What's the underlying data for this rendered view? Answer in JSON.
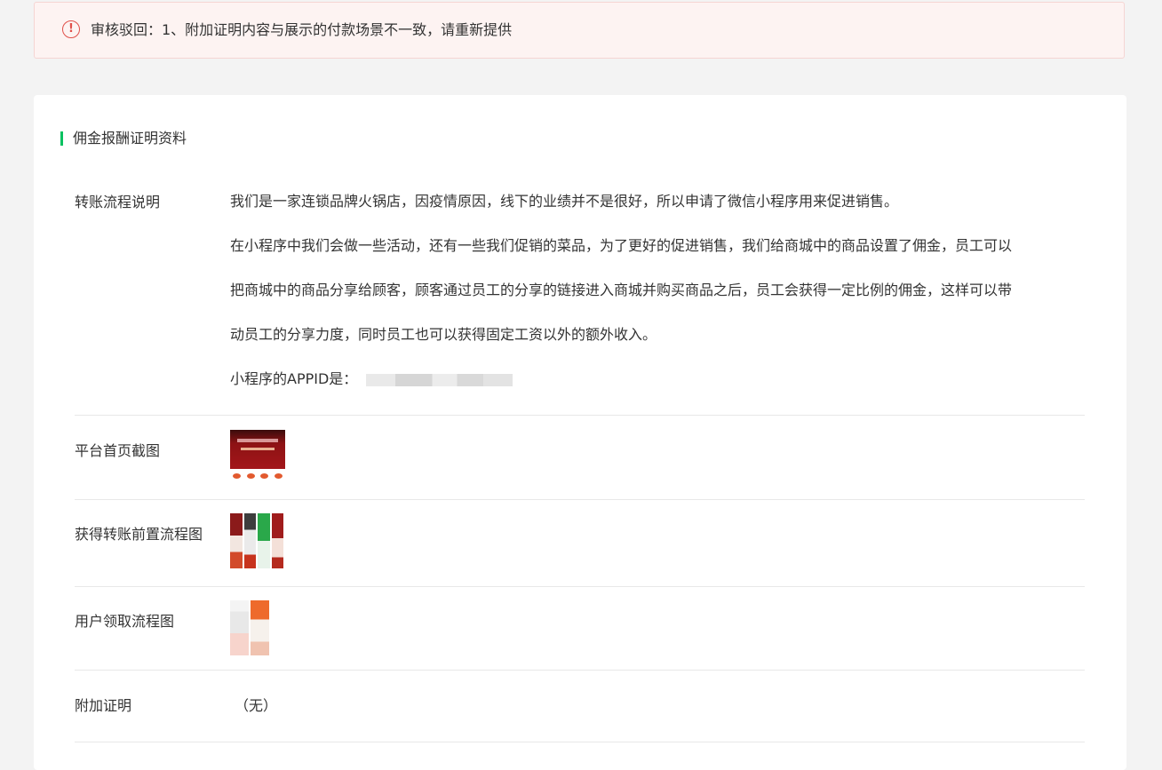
{
  "alert": {
    "text": "审核驳回：1、附加证明内容与展示的付款场景不一致，请重新提供",
    "color": "#e0504a"
  },
  "section": {
    "title": "佣金报酬证明资料",
    "accent": "#07c160"
  },
  "rows": {
    "transfer_flow": {
      "label": "转账流程说明",
      "lines": [
        "我们是一家连锁品牌火锅店，因疫情原因，线下的业绩并不是很好，所以申请了微信小程序用来促进销售。",
        "在小程序中我们会做一些活动，还有一些我们促销的菜品，为了更好的促进销售，我们给商城中的商品设置了佣金，员工可以",
        "把商城中的商品分享给顾客，顾客通过员工的分享的链接进入商城并购买商品之后，员工会获得一定比例的佣金，这样可以带",
        "动员工的分享力度，同时员工也可以获得固定工资以外的额外收入。"
      ],
      "appid_label": "小程序的APPID是："
    },
    "homepage": {
      "label": "平台首页截图"
    },
    "pre_transfer": {
      "label": "获得转账前置流程图"
    },
    "user_claim": {
      "label": "用户领取流程图"
    },
    "extra": {
      "label": "附加证明",
      "value": "（无）"
    }
  }
}
